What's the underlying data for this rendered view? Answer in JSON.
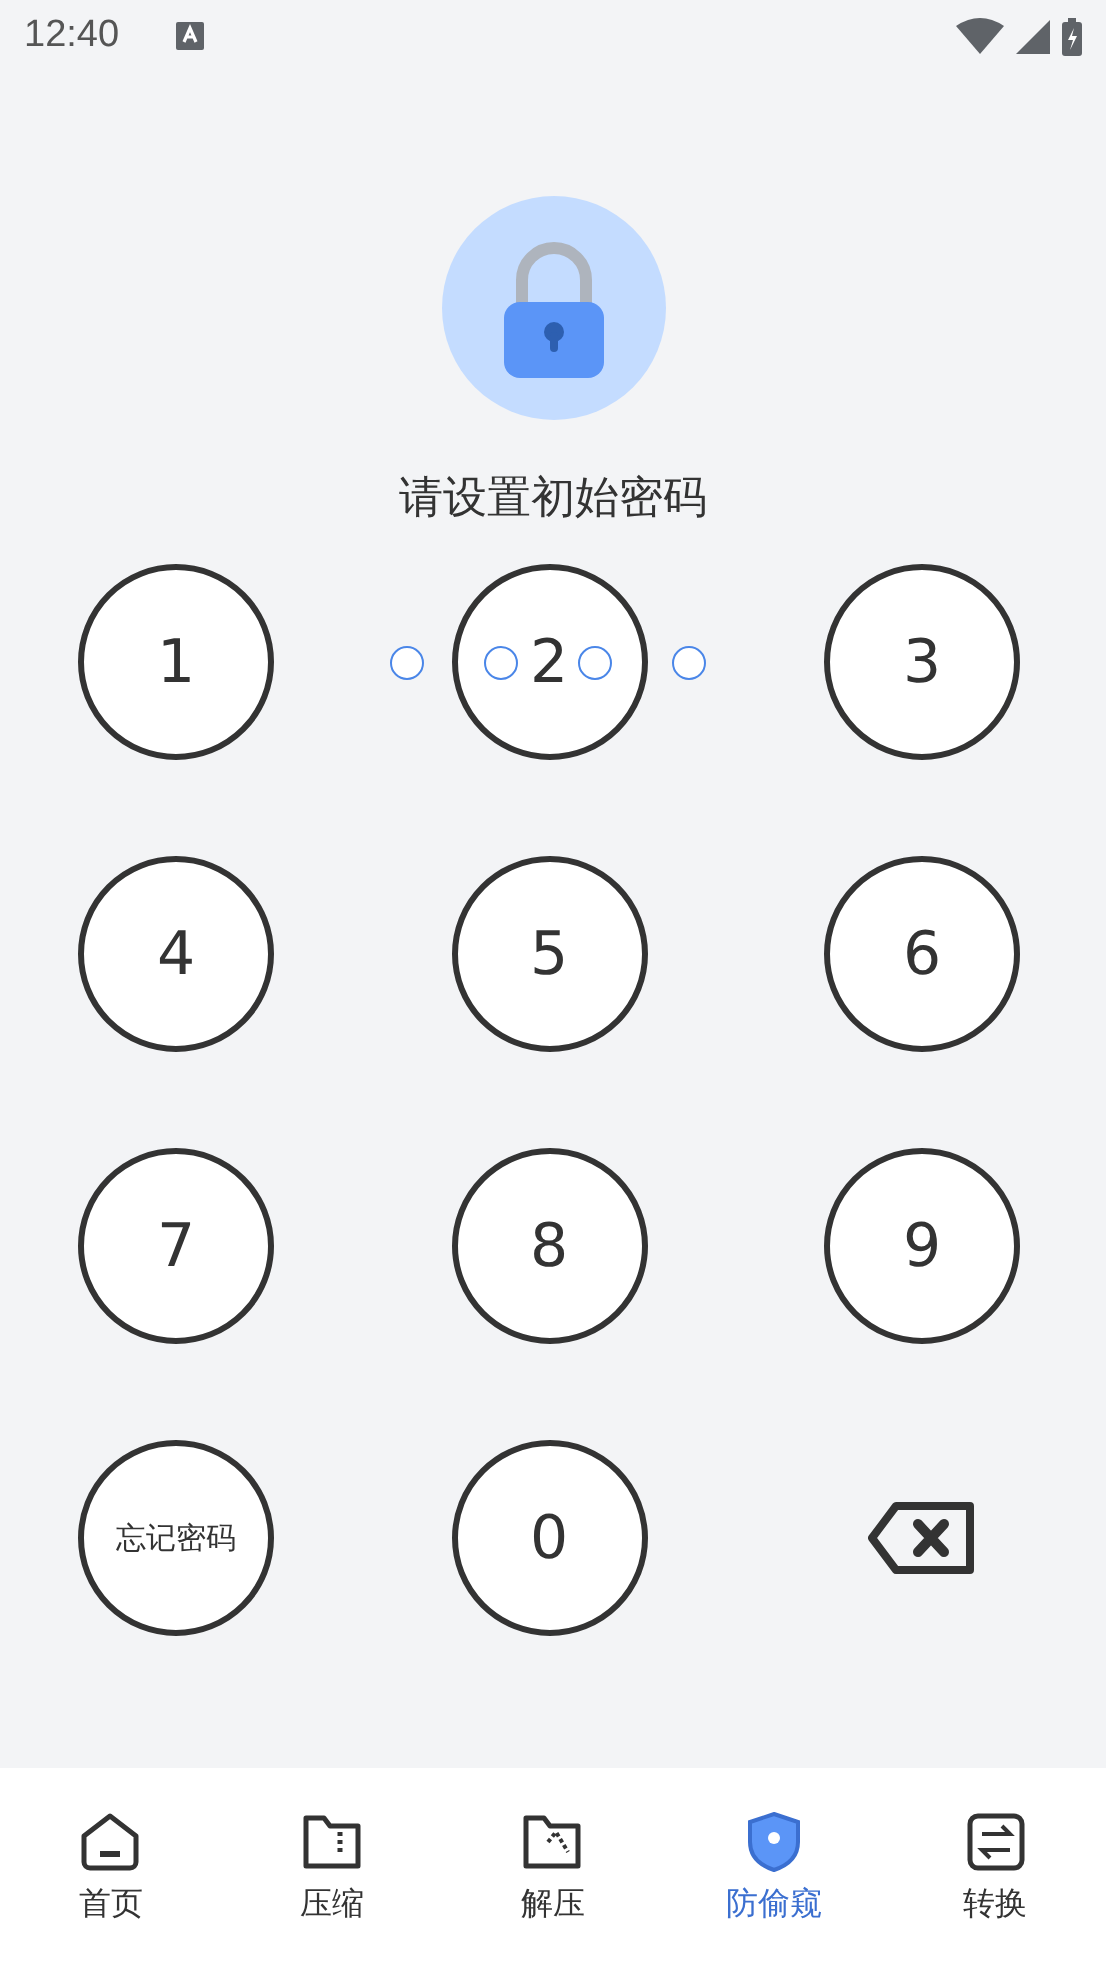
{
  "status_bar": {
    "time": "12:40"
  },
  "prompt": "请设置初始密码",
  "pin_dots": [
    {
      "filled": false
    },
    {
      "filled": false
    },
    {
      "filled": false
    },
    {
      "filled": false
    }
  ],
  "keypad": [
    {
      "kind": "digit",
      "label": "1"
    },
    {
      "kind": "digit",
      "label": "2"
    },
    {
      "kind": "digit",
      "label": "3"
    },
    {
      "kind": "digit",
      "label": "4"
    },
    {
      "kind": "digit",
      "label": "5"
    },
    {
      "kind": "digit",
      "label": "6"
    },
    {
      "kind": "digit",
      "label": "7"
    },
    {
      "kind": "digit",
      "label": "8"
    },
    {
      "kind": "digit",
      "label": "9"
    },
    {
      "kind": "text",
      "label": "忘记密码"
    },
    {
      "kind": "digit",
      "label": "0"
    },
    {
      "kind": "backspace"
    }
  ],
  "bottom_nav": [
    {
      "label": "首页",
      "selected": false
    },
    {
      "label": "压缩",
      "selected": false
    },
    {
      "label": "解压",
      "selected": false
    },
    {
      "label": "防偷窥",
      "selected": true
    },
    {
      "label": "转换",
      "selected": false
    }
  ]
}
